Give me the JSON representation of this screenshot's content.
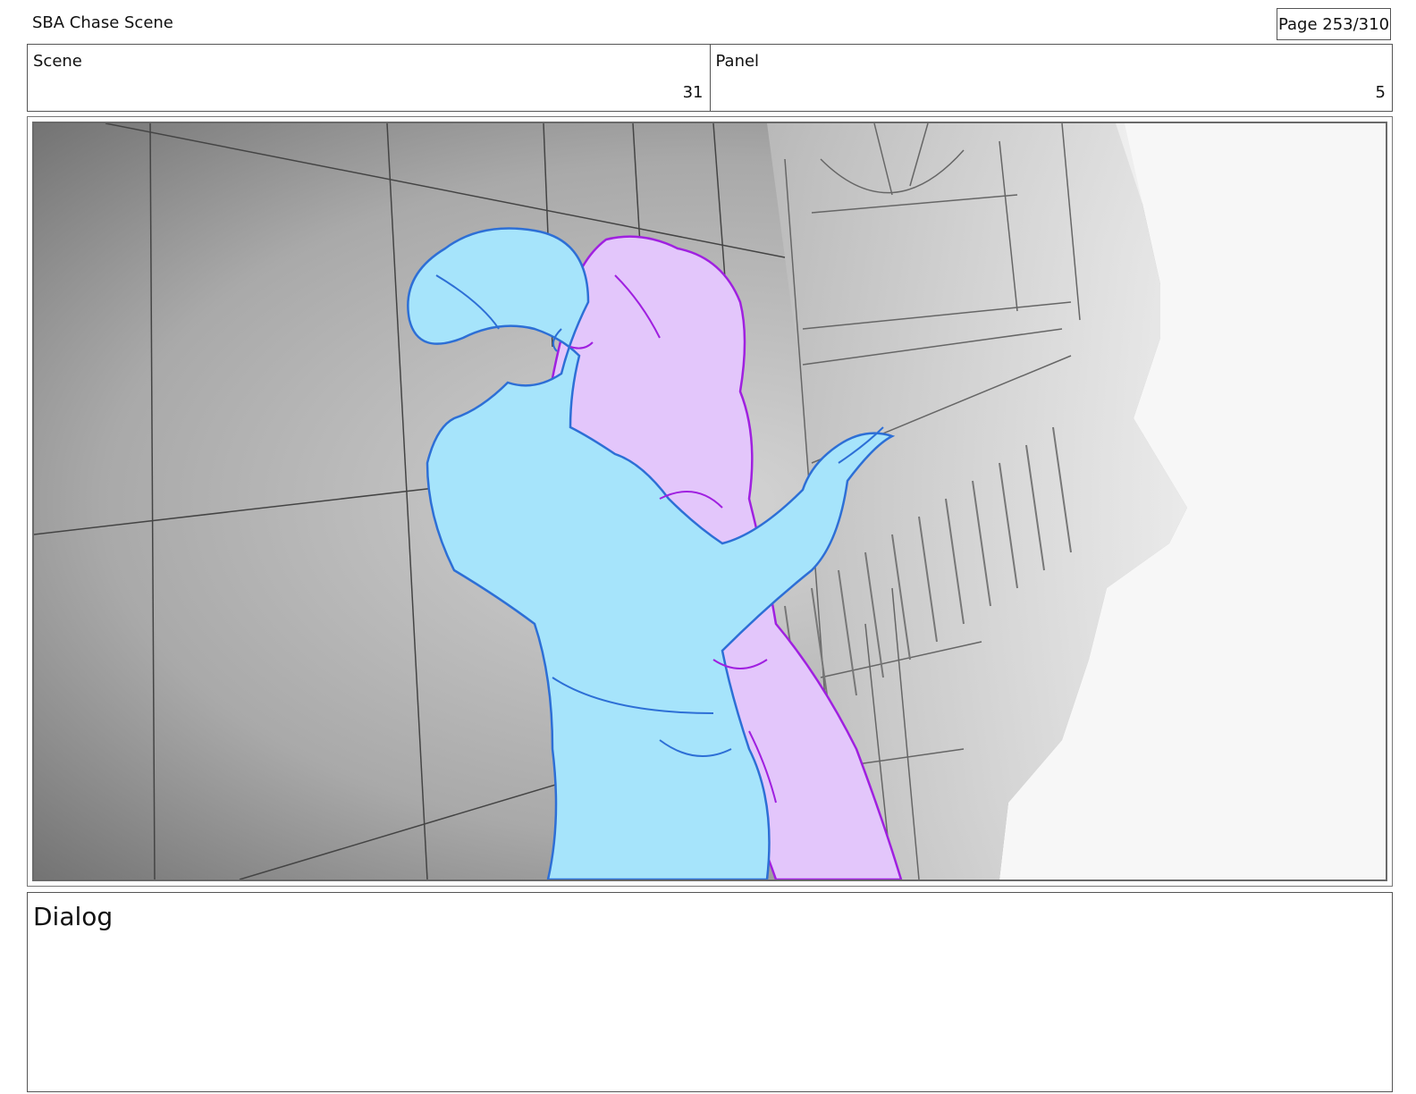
{
  "header": {
    "title": "SBA Chase Scene",
    "page_indicator": "Page 253/310"
  },
  "info": {
    "scene_label": "Scene",
    "scene_value": "31",
    "panel_label": "Panel",
    "panel_value": "5"
  },
  "frame": {
    "colors": {
      "character_left_fill": "#a6e4fb",
      "character_left_line": "#2d6fd6",
      "character_right_fill": "#e3c6fb",
      "character_right_line": "#a020e0"
    }
  },
  "dialog": {
    "label": "Dialog"
  }
}
